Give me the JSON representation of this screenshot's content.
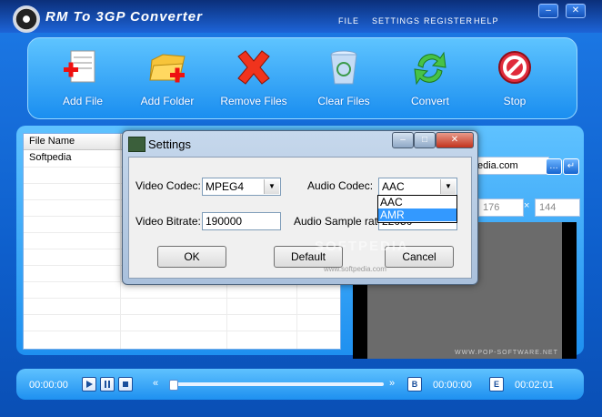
{
  "title": "RM To 3GP Converter",
  "menu": [
    "FILE",
    "SETTINGS",
    "REGISTER",
    "HELP"
  ],
  "toolbar": [
    "Add File",
    "Add Folder",
    "Remove Files",
    "Clear Files",
    "Convert",
    "Stop"
  ],
  "filelist": {
    "header": "File Name",
    "rows": [
      "Softpedia"
    ]
  },
  "right_panel": {
    "url_text": "edia.com",
    "width": "176",
    "height": "144",
    "times": "×"
  },
  "preview_credit": "WWW.POP-SOFTWARE.NET",
  "transport": {
    "time_left": "00:00:00",
    "time_mid": "00:00:00",
    "time_total": "00:02:01",
    "b_label": "B",
    "e_label": "E",
    "back": "«",
    "forward": "»"
  },
  "dialog": {
    "title": "Settings",
    "video_codec_label": "Video Codec:",
    "video_codec_value": "MPEG4",
    "video_bitrate_label": "Video Bitrate:",
    "video_bitrate_value": "190000",
    "audio_codec_label": "Audio Codec:",
    "audio_codec_value": "AAC",
    "audio_codec_options": [
      "AAC",
      "AMR"
    ],
    "audio_sample_label": "Audio Sample rate:",
    "audio_sample_value": "22050",
    "ok": "OK",
    "default": "Default",
    "cancel": "Cancel"
  },
  "watermark": "SOFTPEDIA",
  "watermark_url": "www.softpedia.com"
}
